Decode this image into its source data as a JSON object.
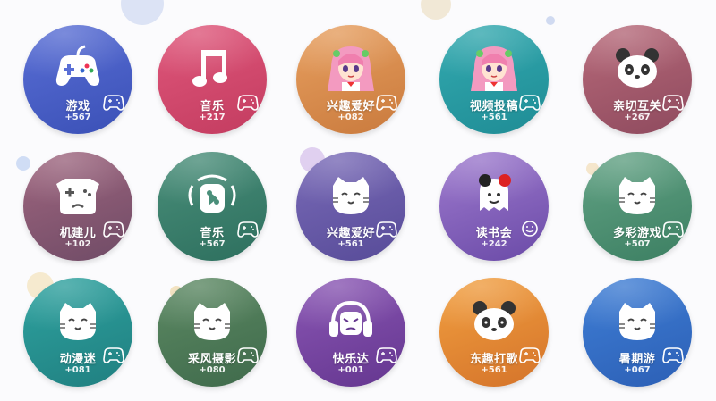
{
  "tiles": [
    {
      "label": "游戏",
      "count": "+567",
      "color1": "#5a6fd6",
      "color2": "#3a50b6",
      "art": "gamepad-icon",
      "badge": "controller-badge-icon"
    },
    {
      "label": "音乐",
      "count": "+217",
      "color1": "#e0577b",
      "color2": "#c33c60",
      "art": "music-note-icon",
      "badge": "controller-badge-icon"
    },
    {
      "label": "兴趣爱好",
      "count": "+082",
      "color1": "#e8a060",
      "color2": "#c97a3d",
      "art": "anime-girl-icon",
      "badge": "controller-badge-icon"
    },
    {
      "label": "视频投稿",
      "count": "+561",
      "color1": "#33aab0",
      "color2": "#1f8c95",
      "art": "anime-girl-icon",
      "badge": "controller-badge-icon"
    },
    {
      "label": "亲切互关",
      "count": "+267",
      "color1": "#b86a7a",
      "color2": "#8e4a5e",
      "art": "panda-icon",
      "badge": "controller-badge-icon"
    },
    {
      "label": "机建儿",
      "count": "+102",
      "color1": "#a0667f",
      "color2": "#6f4b66",
      "art": "robot-dog-icon",
      "badge": "controller-badge-icon"
    },
    {
      "label": "音乐",
      "count": "+567",
      "color1": "#4a8f7a",
      "color2": "#2d6f5e",
      "art": "speaker-icon",
      "badge": "controller-badge-icon"
    },
    {
      "label": "兴趣爱好",
      "count": "+561",
      "color1": "#7a6bb8",
      "color2": "#574b98",
      "art": "cat-face-icon",
      "badge": "controller-badge-icon"
    },
    {
      "label": "读书会",
      "count": "+242",
      "color1": "#9f7bcf",
      "color2": "#6a4aa7",
      "art": "ghost-icon",
      "badge": "smile-badge-icon"
    },
    {
      "label": "多彩游戏",
      "count": "+507",
      "color1": "#63a385",
      "color2": "#3c7f62",
      "art": "cat-face-icon",
      "badge": "controller-badge-icon"
    },
    {
      "label": "动漫迷",
      "count": "+081",
      "color1": "#2ea3a0",
      "color2": "#207f80",
      "art": "cat-face-icon",
      "badge": "controller-badge-icon"
    },
    {
      "label": "采风摄影",
      "count": "+080",
      "color1": "#5d8a64",
      "color2": "#3f6a4b",
      "art": "cat-face-icon",
      "badge": "controller-badge-icon"
    },
    {
      "label": "快乐达",
      "count": "+001",
      "color1": "#8b57b5",
      "color2": "#64368f",
      "art": "headphones-icon",
      "badge": "controller-badge-icon"
    },
    {
      "label": "东趣打歌",
      "count": "+561",
      "color1": "#f2a040",
      "color2": "#d4732a",
      "art": "panda-icon",
      "badge": "controller-badge-icon"
    },
    {
      "label": "暑期游",
      "count": "+067",
      "color1": "#3f7fd6",
      "color2": "#2c5fb5",
      "art": "cat-face-icon",
      "badge": "controller-badge-icon"
    }
  ]
}
